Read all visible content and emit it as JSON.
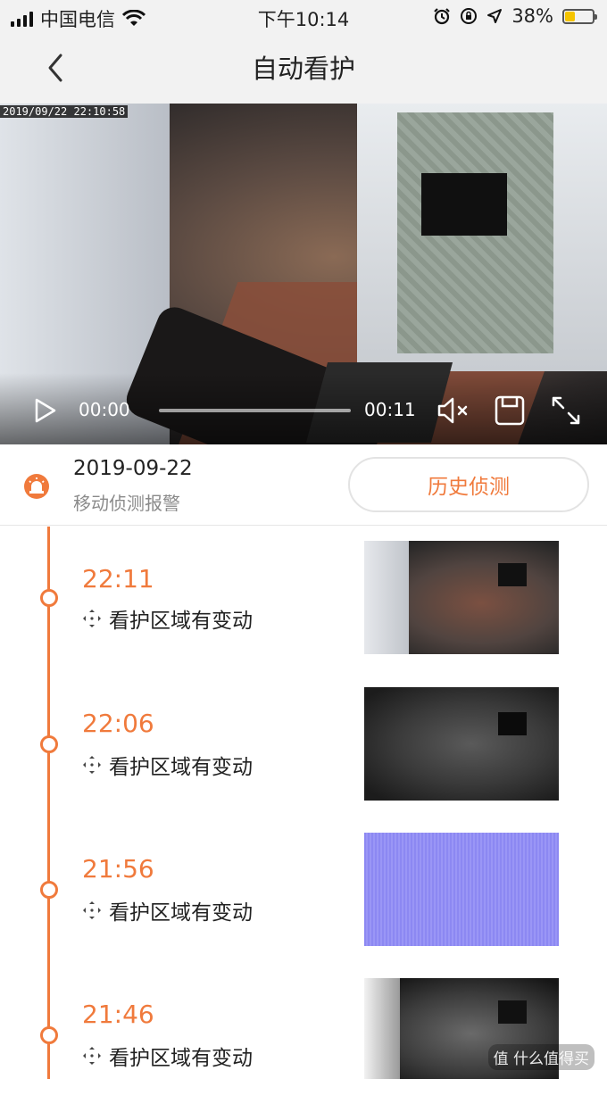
{
  "status": {
    "carrier": "中国电信",
    "time": "下午10:14",
    "battery": "38%",
    "battery_level": 0.38
  },
  "nav": {
    "title": "自动看护"
  },
  "video": {
    "timestamp": "2019/09/22  22:10:58",
    "current_time": "00:00",
    "duration": "00:11",
    "progress": 0
  },
  "alarm": {
    "date": "2019-09-22",
    "subtitle": "移动侦测报警",
    "history_button": "历史侦测"
  },
  "events": [
    {
      "time": "22:11",
      "desc": "看护区域有变动"
    },
    {
      "time": "22:06",
      "desc": "看护区域有变动"
    },
    {
      "time": "21:56",
      "desc": "看护区域有变动"
    },
    {
      "time": "21:46",
      "desc": "看护区域有变动"
    }
  ],
  "watermark": "值 什么值得买",
  "colors": {
    "accent": "#f07a3c"
  }
}
